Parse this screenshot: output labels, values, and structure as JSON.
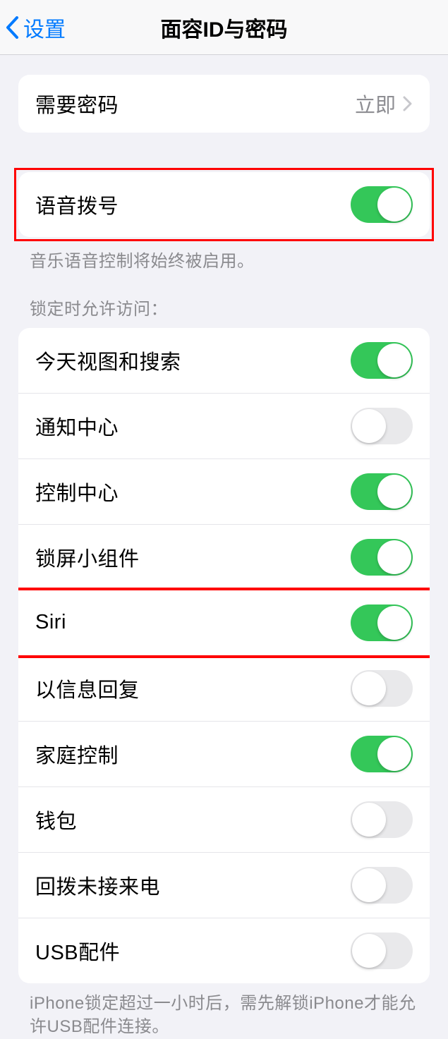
{
  "header": {
    "back_label": "设置",
    "title": "面容ID与密码"
  },
  "require_passcode": {
    "label": "需要密码",
    "value": "立即"
  },
  "voice_dial": {
    "label": "语音拨号",
    "enabled": true,
    "footer": "音乐语音控制将始终被启用。"
  },
  "lock_access": {
    "header": "锁定时允许访问：",
    "items": [
      {
        "label": "今天视图和搜索",
        "enabled": true
      },
      {
        "label": "通知中心",
        "enabled": false
      },
      {
        "label": "控制中心",
        "enabled": true
      },
      {
        "label": "锁屏小组件",
        "enabled": true
      },
      {
        "label": "Siri",
        "enabled": true
      },
      {
        "label": "以信息回复",
        "enabled": false
      },
      {
        "label": "家庭控制",
        "enabled": true
      },
      {
        "label": "钱包",
        "enabled": false
      },
      {
        "label": "回拨未接来电",
        "enabled": false
      },
      {
        "label": "USB配件",
        "enabled": false
      }
    ],
    "footer": "iPhone锁定超过一小时后，需先解锁iPhone才能允许USB配件连接。"
  }
}
